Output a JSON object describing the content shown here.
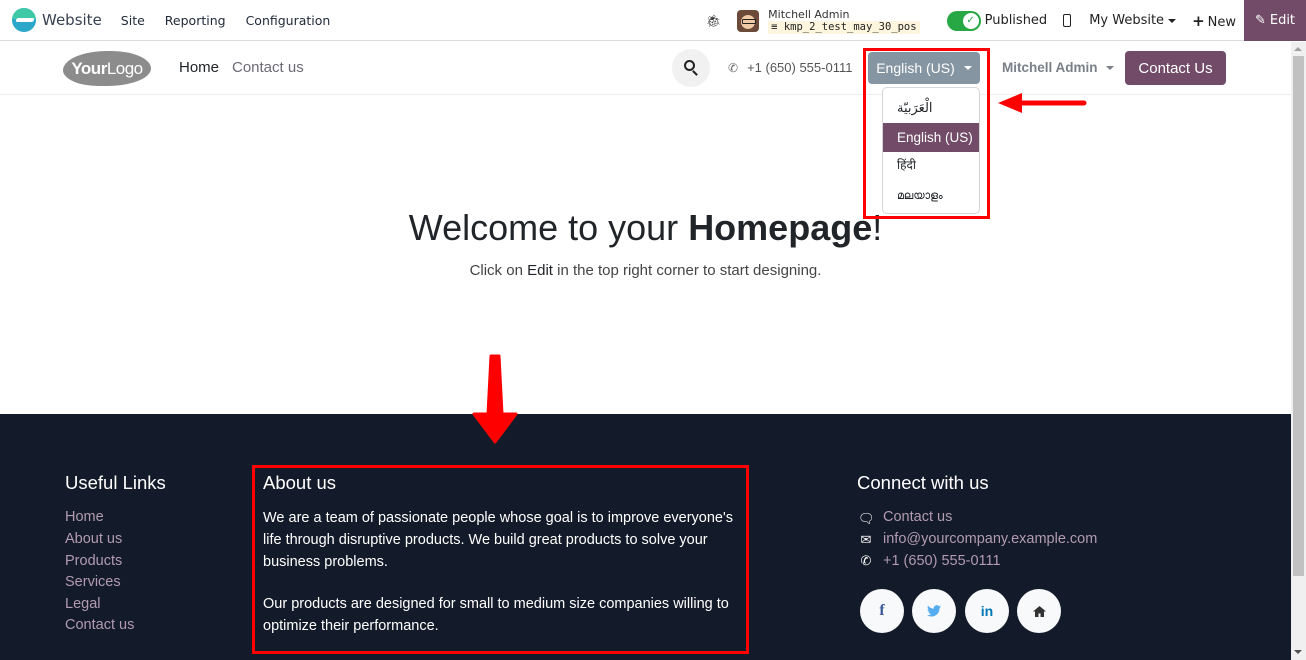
{
  "admin_bar": {
    "app_name": "Website",
    "menus": [
      "Site",
      "Reporting",
      "Configuration"
    ],
    "user_name": "Mitchell Admin",
    "database": "kmp_2_test_may_30_pos",
    "published_label": "Published",
    "published": true,
    "website_selector": "My Website",
    "new_label": "New",
    "edit_label": "Edit",
    "icons": {
      "app": "odoo-website-icon",
      "debug": "bug-icon",
      "mobile": "mobile-icon",
      "new": "plus-icon",
      "edit": "pencil-icon",
      "db": "database-icon"
    }
  },
  "site_header": {
    "logo_text_bold": "Your",
    "logo_text": "Logo",
    "nav": [
      "Home",
      "Contact us"
    ],
    "phone": "+1 (650) 555-0111",
    "language_selected": "English (US)",
    "user_menu": "Mitchell Admin",
    "cta_label": "Contact Us"
  },
  "language_dropdown": {
    "items": [
      {
        "label": "الْعَرَبيّة",
        "active": false
      },
      {
        "label": "English (US)",
        "active": true
      },
      {
        "label": "हिंदी",
        "active": false
      },
      {
        "label": "മലയാളം",
        "active": false
      }
    ]
  },
  "hero": {
    "title_prefix": "Welcome to your ",
    "title_bold": "Homepage",
    "title_suffix": "!",
    "subtitle_prefix": "Click on ",
    "subtitle_bold": "Edit",
    "subtitle_suffix": " in the top right corner to start designing."
  },
  "footer": {
    "useful_links": {
      "title": "Useful Links",
      "links": [
        "Home",
        "About us",
        "Products",
        "Services",
        "Legal",
        "Contact us"
      ]
    },
    "about": {
      "title": "About us",
      "paragraph1": "We are a team of passionate people whose goal is to improve everyone's life through disruptive products. We build great products to solve your business problems.",
      "paragraph2": "Our products are designed for small to medium size companies willing to optimize their performance."
    },
    "connect": {
      "title": "Connect with us",
      "items": [
        {
          "icon": "comment-icon",
          "label": "Contact us"
        },
        {
          "icon": "envelope-icon",
          "label": "info@yourcompany.example.com"
        },
        {
          "icon": "phone-icon",
          "label": "+1 (650) 555-0111"
        }
      ],
      "social": [
        {
          "name": "facebook",
          "glyph": "f",
          "color": "#3b5998"
        },
        {
          "name": "twitter",
          "glyph": "🐦",
          "color": "#55acee"
        },
        {
          "name": "linkedin",
          "glyph": "in",
          "color": "#0077b5"
        },
        {
          "name": "home",
          "glyph": "⌂",
          "color": "#333333"
        }
      ]
    }
  },
  "colors": {
    "brand": "#714b67",
    "footer_bg": "#131a29",
    "language_button": "#8595a2",
    "published_toggle": "#28a745",
    "annotation": "#ff0000",
    "footer_link": "#b29bb0"
  }
}
